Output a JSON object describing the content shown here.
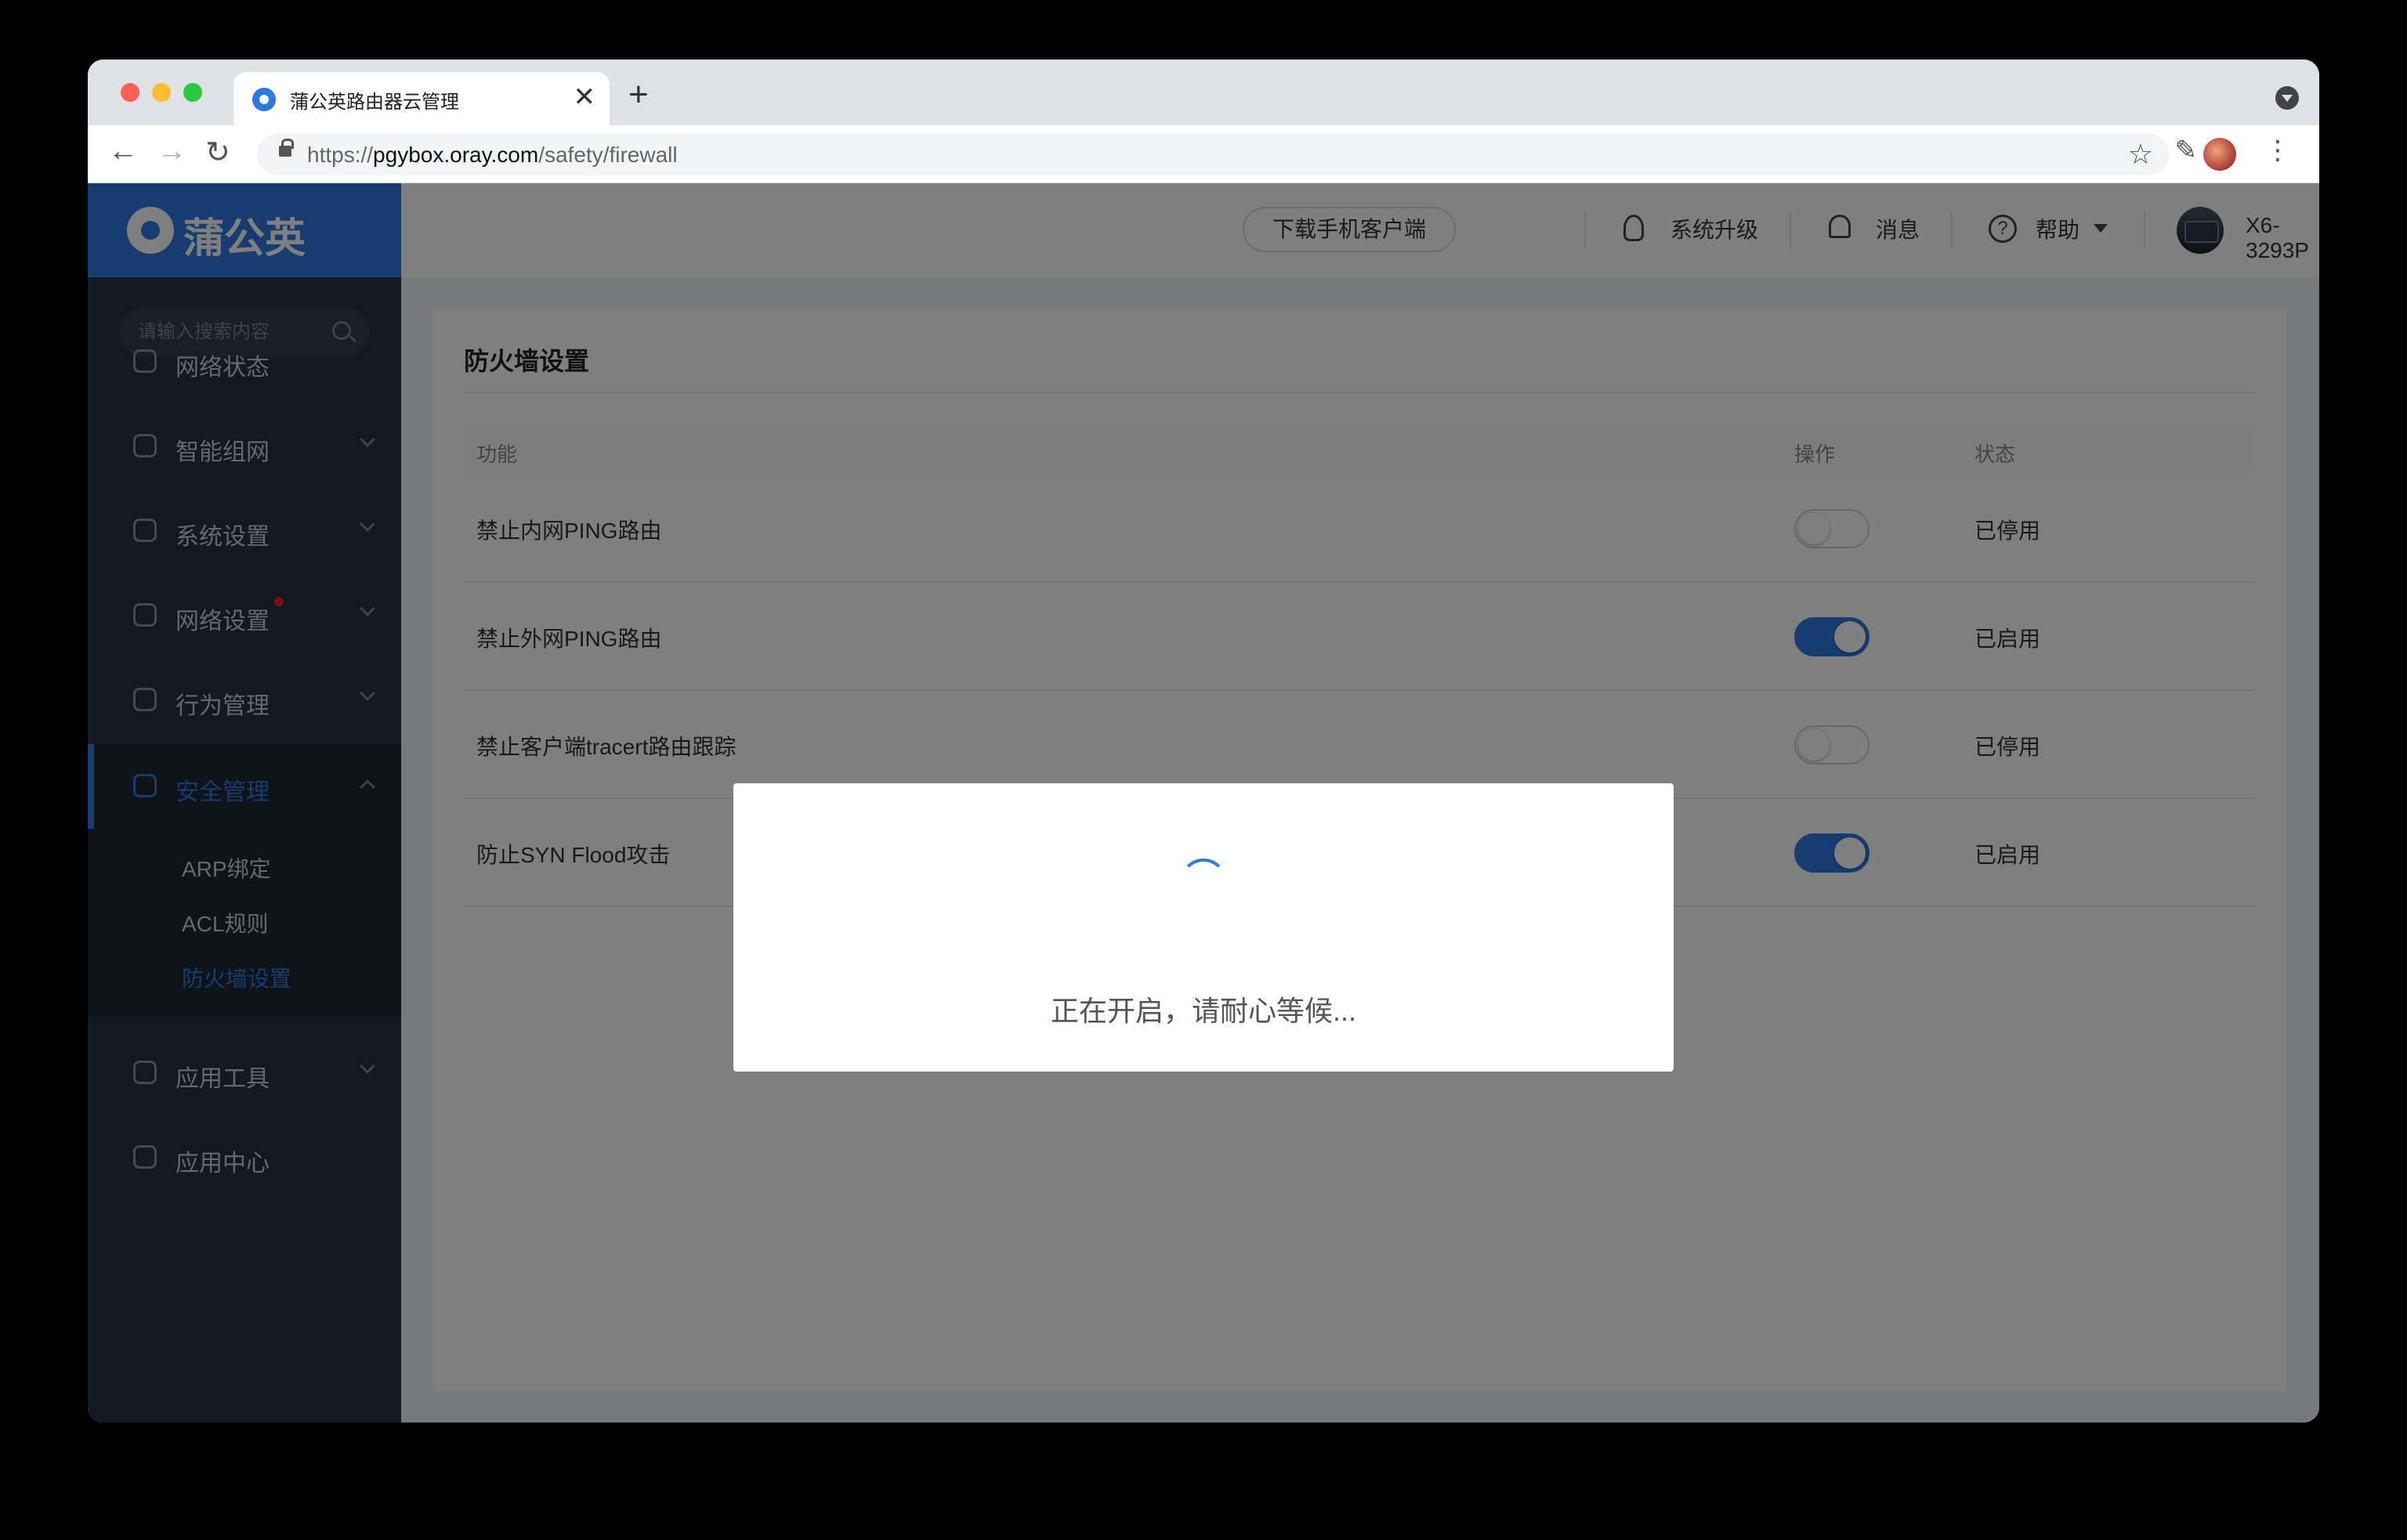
{
  "browser": {
    "tab_title": "蒲公英路由器云管理",
    "close_glyph": "✕",
    "new_tab_glyph": "+",
    "url_scheme": "https://",
    "url_host": "pgybox.oray.com",
    "url_path": "/safety/firewall"
  },
  "sidebar": {
    "brand": "蒲公英",
    "search_placeholder": "请输入搜索内容",
    "items": [
      {
        "label": "网络状态",
        "icon": "network-status-icon"
      },
      {
        "label": "智能组网",
        "icon": "smart-network-icon"
      },
      {
        "label": "系统设置",
        "icon": "gear-icon"
      },
      {
        "label": "网络设置",
        "icon": "network-settings-icon"
      },
      {
        "label": "行为管理",
        "icon": "behavior-icon"
      },
      {
        "label": "安全管理",
        "icon": "shield-icon"
      },
      {
        "label": "应用工具",
        "icon": "toolbox-icon"
      },
      {
        "label": "应用中心",
        "icon": "cube-icon"
      }
    ],
    "sub_items": [
      "ARP绑定",
      "ACL规则",
      "防火墙设置"
    ]
  },
  "header": {
    "download_label": "下载手机客户端",
    "upgrade_label": "系统升级",
    "messages_label": "消息",
    "help_label": "帮助",
    "device_name": "X6-3293P"
  },
  "main": {
    "title": "防火墙设置",
    "columns": {
      "function": "功能",
      "action": "操作",
      "status": "状态"
    },
    "rows": [
      {
        "function": "禁止内网PING路由",
        "enabled": false,
        "status": "已停用"
      },
      {
        "function": "禁止外网PING路由",
        "enabled": true,
        "status": "已启用"
      },
      {
        "function": "禁止客户端tracert路由跟踪",
        "enabled": false,
        "status": "已停用"
      },
      {
        "function": "防止SYN Flood攻击",
        "enabled": true,
        "status": "已启用"
      }
    ]
  },
  "modal": {
    "message": "正在开启，请耐心等候..."
  },
  "colors": {
    "accent": "#2f79df",
    "sidebar_bg": "#273142"
  }
}
